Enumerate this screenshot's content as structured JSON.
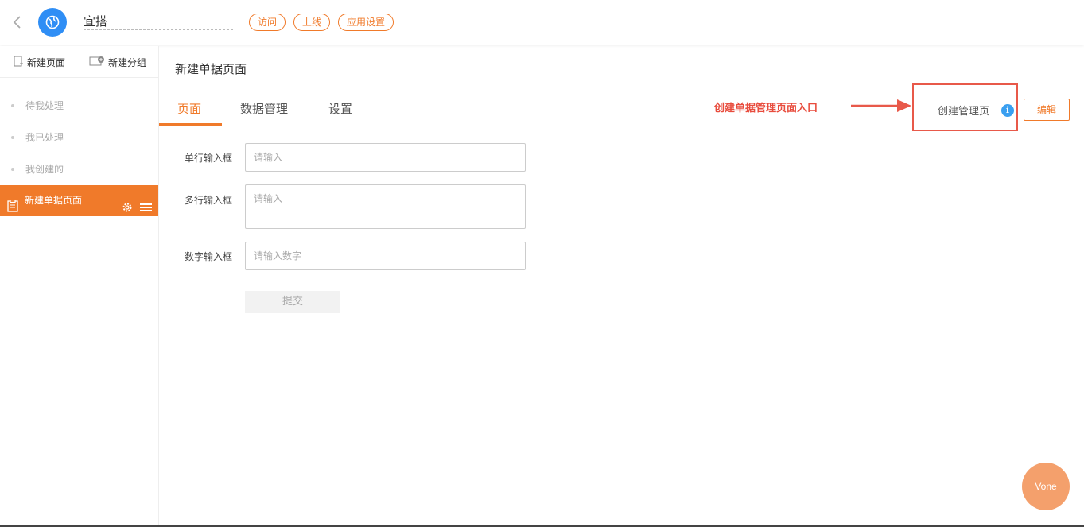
{
  "header": {
    "app_name": "宜搭",
    "tags": [
      "访问",
      "上线",
      "应用设置"
    ]
  },
  "sidebar": {
    "actions": {
      "new_page": "新建页面",
      "new_group": "新建分组"
    },
    "items": [
      "待我处理",
      "我已处理",
      "我创建的"
    ],
    "active_item": "新建单据页面"
  },
  "main": {
    "title": "新建单据页面",
    "tabs": [
      "页面",
      "数据管理",
      "设置"
    ],
    "active_tab": "页面",
    "annotation": "创建单据管理页面入口",
    "manage_page_label": "创建管理页",
    "info_symbol": "i",
    "edit_label": "编辑"
  },
  "form": {
    "fields": [
      {
        "label": "单行输入框",
        "placeholder": "请输入"
      },
      {
        "label": "多行输入框",
        "placeholder": "请输入"
      },
      {
        "label": "数字输入框",
        "placeholder": "请输入数字"
      }
    ],
    "submit_label": "提交"
  },
  "floating": {
    "vone_label": "Vone"
  },
  "colors": {
    "accent": "#f07a2a",
    "annotation": "#e8594a",
    "logo": "#2f8ef5",
    "info": "#3a9ff0"
  }
}
